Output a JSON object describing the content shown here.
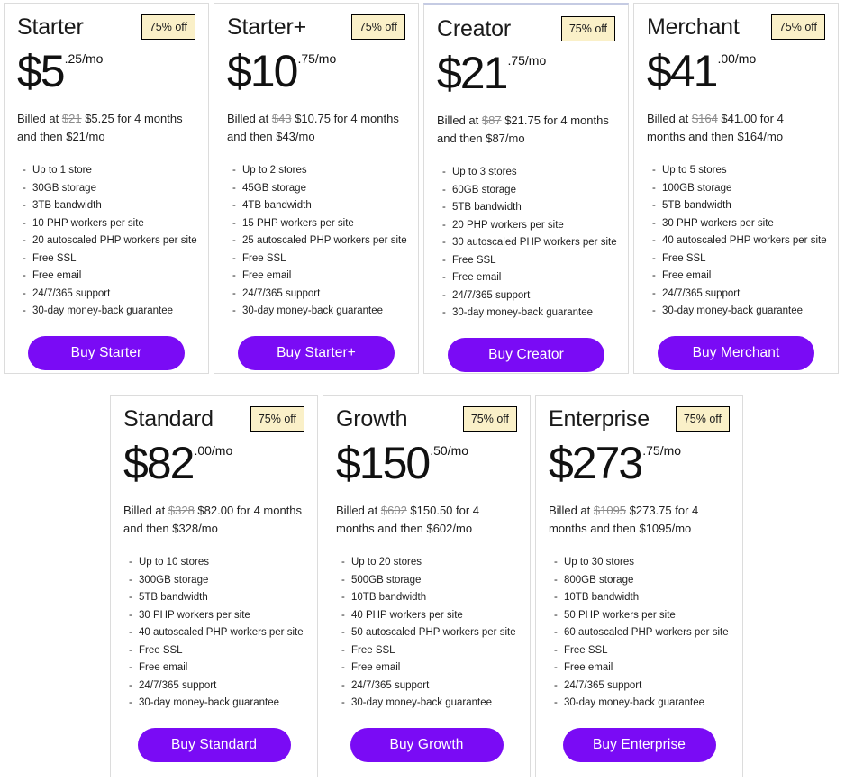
{
  "accent_color": "#7a0bf5",
  "badge_bg": "#faf0c8",
  "badge_border": "#000000",
  "card_border": "#dcdcdc",
  "strike_color": "#8c8c8c",
  "rows": [
    {
      "plans": [
        {
          "name": "Starter",
          "badge": "75% off",
          "price_main": "$5",
          "price_sup": ".25/mo",
          "billed_prefix": "Billed at ",
          "billed_strike": "$21",
          "billed_suffix": " $5.25 for 4 months and then $21/mo",
          "features": [
            "Up to 1 store",
            "30GB storage",
            "3TB bandwidth",
            "10 PHP workers per site",
            "20 autoscaled PHP workers per site",
            "Free SSL",
            "Free email",
            "24/7/365 support",
            "30-day money-back guarantee"
          ],
          "buy_label": "Buy Starter",
          "highlight": false
        },
        {
          "name": "Starter+",
          "badge": "75% off",
          "price_main": "$10",
          "price_sup": ".75/mo",
          "billed_prefix": "Billed at ",
          "billed_strike": "$43",
          "billed_suffix": " $10.75 for 4 months and then $43/mo",
          "features": [
            "Up to 2 stores",
            "45GB storage",
            "4TB bandwidth",
            "15 PHP workers per site",
            "25 autoscaled PHP workers per site",
            "Free SSL",
            "Free email",
            "24/7/365 support",
            "30-day money-back guarantee"
          ],
          "buy_label": "Buy Starter+",
          "highlight": false
        },
        {
          "name": "Creator",
          "badge": "75% off",
          "price_main": "$21",
          "price_sup": ".75/mo",
          "billed_prefix": "Billed at ",
          "billed_strike": "$87",
          "billed_suffix": " $21.75 for 4 months and then $87/mo",
          "features": [
            "Up to 3 stores",
            "60GB storage",
            "5TB bandwidth",
            "20 PHP workers per site",
            "30 autoscaled PHP workers per site",
            "Free SSL",
            "Free email",
            "24/7/365 support",
            "30-day money-back guarantee"
          ],
          "buy_label": "Buy Creator",
          "highlight": true
        },
        {
          "name": "Merchant",
          "badge": "75% off",
          "price_main": "$41",
          "price_sup": ".00/mo",
          "billed_prefix": "Billed at ",
          "billed_strike": "$164",
          "billed_suffix": " $41.00 for 4 months and then $164/mo",
          "features": [
            "Up to 5 stores",
            "100GB storage",
            "5TB bandwidth",
            "30 PHP workers per site",
            "40 autoscaled PHP workers per site",
            "Free SSL",
            "Free email",
            "24/7/365 support",
            "30-day money-back guarantee"
          ],
          "buy_label": "Buy Merchant",
          "highlight": false
        }
      ]
    },
    {
      "plans": [
        {
          "name": "Standard",
          "badge": "75% off",
          "price_main": "$82",
          "price_sup": ".00/mo",
          "billed_prefix": "Billed at ",
          "billed_strike": "$328",
          "billed_suffix": " $82.00 for 4 months and then $328/mo",
          "features": [
            "Up to 10 stores",
            "300GB storage",
            "5TB bandwidth",
            "30 PHP workers per site",
            "40 autoscaled PHP workers per site",
            "Free SSL",
            "Free email",
            "24/7/365 support",
            "30-day money-back guarantee"
          ],
          "buy_label": "Buy Standard",
          "highlight": false
        },
        {
          "name": "Growth",
          "badge": "75% off",
          "price_main": "$150",
          "price_sup": ".50/mo",
          "billed_prefix": "Billed at ",
          "billed_strike": "$602",
          "billed_suffix": " $150.50 for 4 months and then $602/mo",
          "features": [
            "Up to 20 stores",
            "500GB storage",
            "10TB bandwidth",
            "40 PHP workers per site",
            "50 autoscaled PHP workers per site",
            "Free SSL",
            "Free email",
            "24/7/365 support",
            "30-day money-back guarantee"
          ],
          "buy_label": "Buy Growth",
          "highlight": false
        },
        {
          "name": "Enterprise",
          "badge": "75% off",
          "price_main": "$273",
          "price_sup": ".75/mo",
          "billed_prefix": "Billed at ",
          "billed_strike": "$1095",
          "billed_suffix": " $273.75 for 4 months and then $1095/mo",
          "features": [
            "Up to 30 stores",
            "800GB storage",
            "10TB bandwidth",
            "50 PHP workers per site",
            "60 autoscaled PHP workers per site",
            "Free SSL",
            "Free email",
            "24/7/365 support",
            "30-day money-back guarantee"
          ],
          "buy_label": "Buy Enterprise",
          "highlight": false
        }
      ]
    }
  ]
}
